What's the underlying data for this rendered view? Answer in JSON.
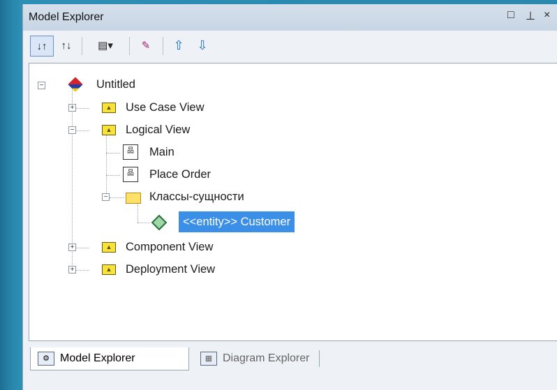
{
  "window": {
    "title": "Model Explorer",
    "controls": [
      "□",
      "⊥",
      "×"
    ]
  },
  "toolbar": {
    "buttons": [
      {
        "name": "sort-ascending",
        "glyph": "↓↑"
      },
      {
        "name": "sort-descending",
        "glyph": "↑↓"
      },
      {
        "name": "view-options",
        "glyph": "▤▾"
      },
      {
        "name": "properties",
        "glyph": "✎"
      },
      {
        "name": "move-up",
        "glyph": "⇧"
      },
      {
        "name": "move-down",
        "glyph": "⇩"
      }
    ]
  },
  "tree": {
    "root": "Untitled",
    "use_case_view": "Use Case View",
    "logical_view": "Logical View",
    "main": "Main",
    "place_order": "Place Order",
    "entities_folder": "Классы-сущности",
    "customer": "<<entity>> Customer",
    "component_view": "Component View",
    "deployment_view": "Deployment View"
  },
  "tabs": {
    "model_explorer": "Model Explorer",
    "diagram_explorer": "Diagram Explorer"
  },
  "colors": {
    "selection": "#3b8fe6",
    "folder": "#f7e23a",
    "background": "#2e8fb6"
  }
}
